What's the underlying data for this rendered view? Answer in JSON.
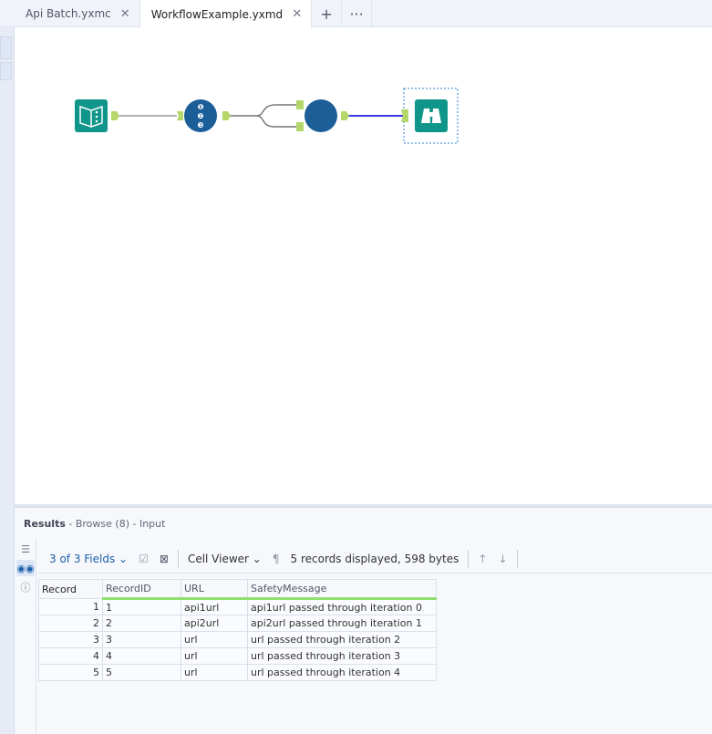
{
  "tabs": [
    {
      "label": "Api Batch.yxmc",
      "active": false
    },
    {
      "label": "WorkflowExample.yxmd",
      "active": true
    }
  ],
  "tab_actions": {
    "add": "+",
    "more": "···"
  },
  "results": {
    "title": "Results",
    "subtitle": " - Browse (8) - Input",
    "toolbar": {
      "fields": "3 of 3 Fields",
      "cell_viewer": "Cell Viewer",
      "status": "5 records displayed, 598 bytes"
    },
    "columns": [
      "Record",
      "RecordID",
      "URL",
      "SafetyMessage"
    ],
    "rows": [
      [
        "1",
        "1",
        "api1url",
        "api1url passed through iteration 0"
      ],
      [
        "2",
        "2",
        "api2url",
        "api2url passed through iteration 1"
      ],
      [
        "3",
        "3",
        "url",
        "url passed through iteration 2"
      ],
      [
        "4",
        "4",
        "url",
        "url passed through iteration 3"
      ],
      [
        "5",
        "5",
        "url",
        "url passed through iteration 4"
      ]
    ]
  },
  "colors": {
    "tool_teal": "#10958a",
    "tool_blue": "#1b5e98",
    "anchor": "#b5d66a",
    "selected_connection": "#3a3ae0"
  }
}
